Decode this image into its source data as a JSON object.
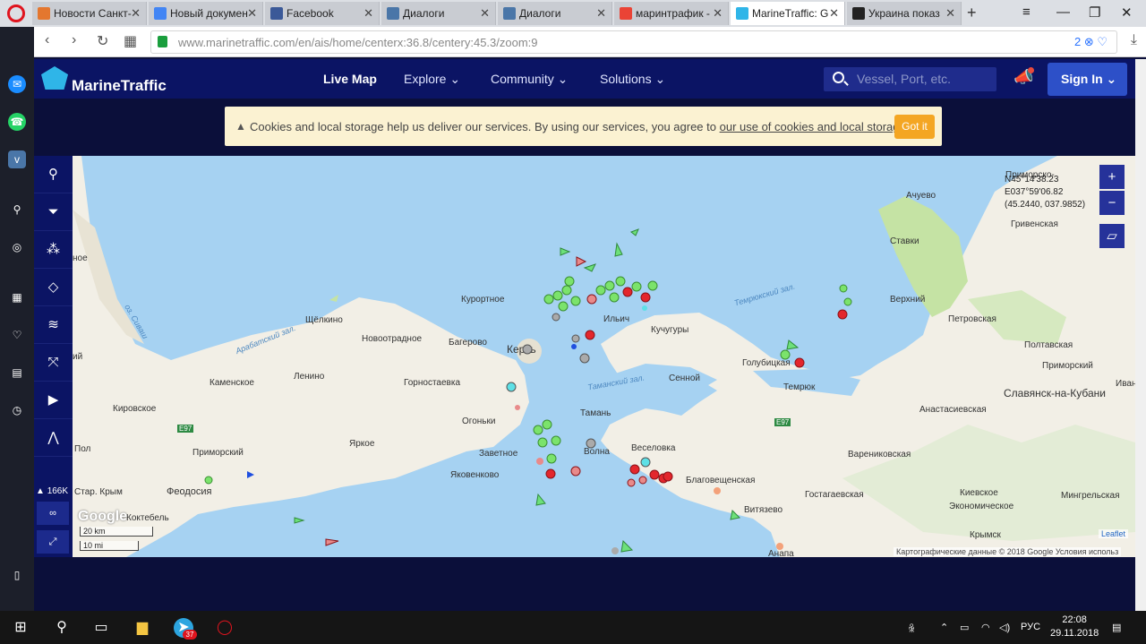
{
  "browser": {
    "tabs": [
      {
        "title": "Новости Санкт-",
        "color": "#e4772f"
      },
      {
        "title": "Новый докумен",
        "color": "#4285f4"
      },
      {
        "title": "Facebook",
        "color": "#3b5998"
      },
      {
        "title": "Диалоги",
        "color": "#4a76a8"
      },
      {
        "title": "Диалоги",
        "color": "#4a76a8"
      },
      {
        "title": "маринтрафик -",
        "color": "#ea4335"
      },
      {
        "title": "MarineTraffic: G",
        "color": "#2fb5e8"
      },
      {
        "title": "Украина показ",
        "color": "#222222"
      }
    ],
    "url_host": "www.marinetraffic.com",
    "url_path": "/en/ais/home/centerx:36.8/centery:45.3/zoom:9",
    "blocked_count": "2"
  },
  "header": {
    "logo": "MarineTraffic",
    "nav": [
      {
        "label": "Live Map"
      },
      {
        "label": "Explore ⌄"
      },
      {
        "label": "Community ⌄"
      },
      {
        "label": "Solutions ⌄"
      }
    ],
    "search_placeholder": "Vessel, Port, etc.",
    "signin": "Sign In ⌄"
  },
  "cookie": {
    "text": "Cookies and local storage help us deliver our services. By using our services, you agree to ",
    "link": "our use of cookies and local storage",
    "button": "Got it"
  },
  "tools": {
    "vessel_count": "166K",
    "items": [
      "search-icon",
      "filter-icon",
      "density-icon",
      "layers-icon",
      "wind-icon",
      "measure-icon",
      "play-icon",
      "route-icon"
    ]
  },
  "map": {
    "coords": [
      "N45°14'38.23",
      "E037°59'06.82",
      "(45.2440, 037.9852)"
    ],
    "zoom_in": "+",
    "zoom_out": "−",
    "google": "Google",
    "scale_km": "20 km",
    "scale_mi": "10 mi",
    "leaflet": "Leaflet",
    "attribution": "Картографические данные © 2018 Google   Условия использ",
    "labels": [
      "Ачуево",
      "Ставки",
      "Гривенская",
      "Верхний",
      "Петровская",
      "Полтавская",
      "Славянск-на-Кубани",
      "Иванов",
      "Анастасиевская",
      "Варениковская",
      "Гостагаевская",
      "Киевское",
      "Экономическое",
      "Мингрельская",
      "Крымск",
      "Благовещенская",
      "Витязево",
      "Анапа",
      "Веселовка",
      "Волна",
      "Тамань",
      "Сенной",
      "Темрюк",
      "Голубицкая",
      "Кучугуры",
      "Ильич",
      "Керчь",
      "Курортное",
      "Багерово",
      "Новоотрадное",
      "Щёлкино",
      "Ленино",
      "Каменское",
      "Горностаевка",
      "Огоньки",
      "Заветное",
      "Яковенково",
      "Яркое",
      "Приморский",
      "Кировское",
      "Феодосия",
      "Коктебель",
      "Стар. Крым",
      "Приморско-",
      "Пол",
      "Приморский",
      "ное",
      "ий"
    ],
    "water_labels": [
      "Арабатский зал.",
      "Темрюкский зал.",
      "Таманский зал.",
      "оз. Сиваш"
    ],
    "roads": [
      "E97",
      "E97"
    ]
  },
  "taskbar": {
    "lang": "РУС",
    "time": "22:08",
    "date": "29.11.2018",
    "telegram_badge": "37"
  }
}
